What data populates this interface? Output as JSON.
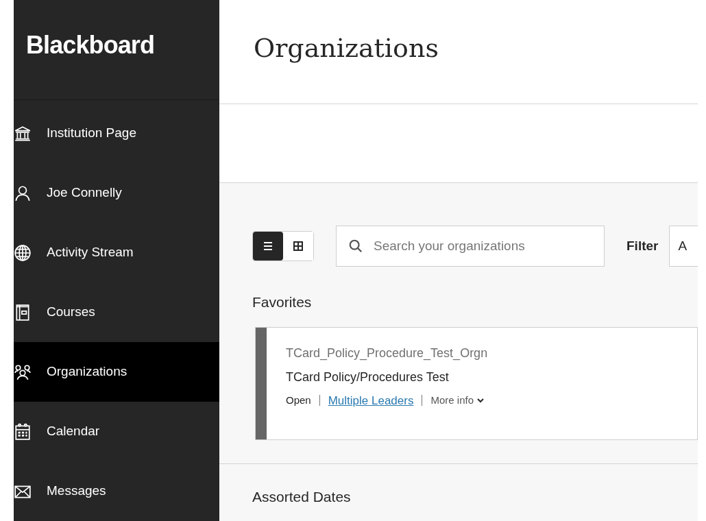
{
  "sidebar": {
    "logo": "Blackboard",
    "items": [
      {
        "label": "Institution Page",
        "kind": "institution",
        "selected": false
      },
      {
        "label": "Joe Connelly",
        "kind": "person",
        "selected": false
      },
      {
        "label": "Activity Stream",
        "kind": "globe",
        "selected": false
      },
      {
        "label": "Courses",
        "kind": "book",
        "selected": false
      },
      {
        "label": "Organizations",
        "kind": "group",
        "selected": true
      },
      {
        "label": "Calendar",
        "kind": "calendar",
        "selected": false
      },
      {
        "label": "Messages",
        "kind": "envelope",
        "selected": false
      }
    ]
  },
  "header": {
    "title": "Organizations"
  },
  "toolbar": {
    "views": [
      {
        "kind": "list",
        "selected": true
      },
      {
        "kind": "grid",
        "selected": false
      }
    ],
    "search": {
      "placeholder": "Search your organizations"
    },
    "filter": {
      "label": "Filter",
      "value": "A"
    }
  },
  "sections": [
    {
      "title": "Favorites",
      "cards": [
        {
          "id_text": "TCard_Policy_Procedure_Test_Orgn",
          "name": "TCard Policy/Procedures Test",
          "status": "Open",
          "leaders": "Multiple Leaders",
          "more": "More info"
        }
      ]
    },
    {
      "title": "Assorted Dates"
    }
  ]
}
